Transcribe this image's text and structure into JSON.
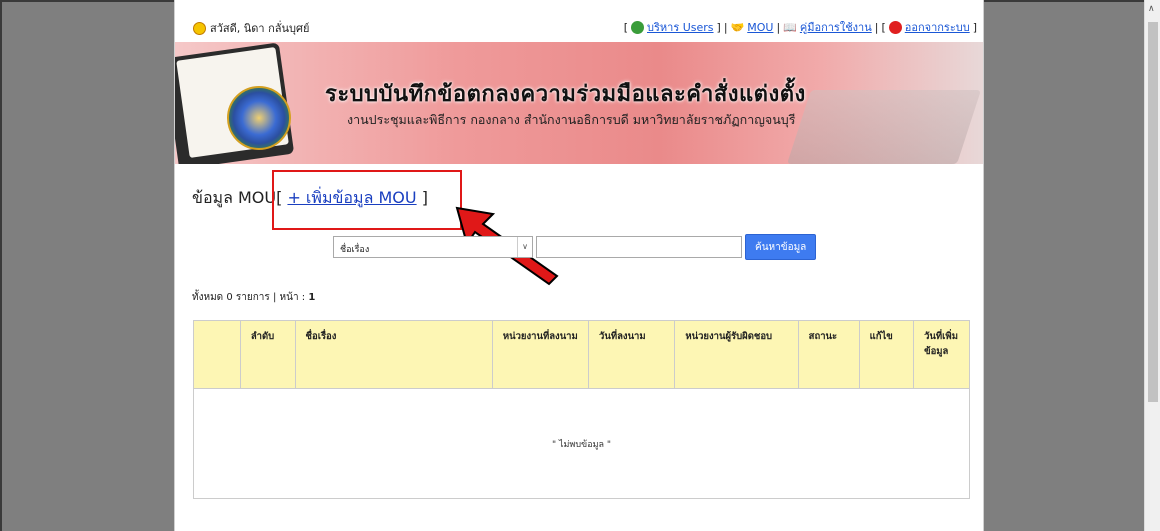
{
  "topbar": {
    "greeting": "สวัสดี, นิดา กลั่นบุศย์",
    "open_bracket": "[",
    "close_bracket": "]",
    "sep": "|",
    "users_link": "บริหาร Users",
    "mou_link": "MOU",
    "manual_link": "คู่มือการใช้งาน",
    "logout_link": "ออกจากระบบ"
  },
  "banner": {
    "title": "ระบบบันทึกข้อตกลงความร่วมมือและคำสั่งแต่งตั้ง",
    "subtitle": "งานประชุมและพิธีการ กองกลาง สำนักงานอธิการบดี มหาวิทยาลัยราชภัฏกาญจนบุรี"
  },
  "heading": {
    "label": "ข้อมูล MOU",
    "open": "[",
    "add_link": "+ เพิ่มข้อมูล MOU",
    "close": "]"
  },
  "search": {
    "field_selected": "ชื่อเรื่อง",
    "query_value": "",
    "button_label": "ค้นหาข้อมูล"
  },
  "summary": {
    "prefix": "ทั้งหมด",
    "count": "0",
    "unit": "รายการ | หน้า :",
    "page": "1"
  },
  "table": {
    "headers": [
      "",
      "ลำดับ",
      "ชื่อเรื่อง",
      "หน่วยงานที่ลงนาม",
      "วันที่ลงนาม",
      "หน่วยงานผู้รับผิดชอบ",
      "สถานะ",
      "แก้ไข",
      "วันที่เพิ่มข้อมูล"
    ],
    "empty_message": "\" ไม่พบข้อมูล \""
  },
  "colors": {
    "header_bg": "#fdf6b4",
    "search_button": "#3e7bf0",
    "highlight_box": "#e01818",
    "link": "#1a57d6"
  },
  "icons": [
    "smiley-icon",
    "user-admin-icon",
    "handshake-icon",
    "book-icon",
    "power-icon",
    "university-seal-icon",
    "red-arrow-icon"
  ]
}
